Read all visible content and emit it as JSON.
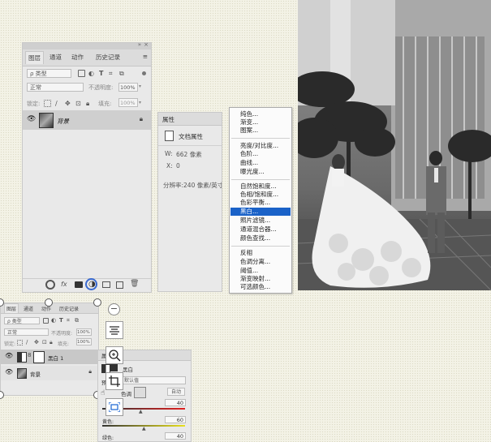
{
  "layers_panel_top": {
    "tabs": [
      "图层",
      "通道",
      "动作",
      "历史记录"
    ],
    "filter_placeholder": "ρ 类型",
    "blend_mode": "正常",
    "opacity_label": "不透明度:",
    "opacity_value": "100%",
    "lock_label": "锁定:",
    "fill_label": "填充:",
    "fill_value": "100%",
    "layer_name": "背景"
  },
  "properties_panel": {
    "title": "属性",
    "doc_label": "文档属性",
    "width_label": "W:",
    "width_value": "662 像素",
    "x_label": "X:",
    "x_value": "0",
    "resolution_label": "分辨率:",
    "resolution_value": "240 像素/英寸"
  },
  "adjustment_menu": {
    "groups": [
      [
        "纯色...",
        "渐变...",
        "图案..."
      ],
      [
        "亮度/对比度...",
        "色阶...",
        "曲线...",
        "曝光度..."
      ],
      [
        "自然饱和度...",
        "色相/饱和度...",
        "色彩平衡...",
        "黑白...",
        "照片滤镜...",
        "通道混合器...",
        "颜色查找..."
      ],
      [
        "反相",
        "色调分离...",
        "阈值...",
        "渐变映射...",
        "可选颜色..."
      ]
    ],
    "selected": "黑白..."
  },
  "layers_panel_bottom": {
    "tabs": [
      "图层",
      "通道",
      "动作",
      "历史记录"
    ],
    "filter_placeholder": "ρ 类型",
    "blend_mode": "正常",
    "opacity_label": "不透明度:",
    "opacity_value": "100%",
    "lock_label": "锁定:",
    "fill_label": "填充:",
    "fill_value": "100%",
    "layer1_name": "黑白 1",
    "layer2_name": "背景"
  },
  "bw_properties": {
    "title": "属性",
    "adjust_label": "黑白",
    "preset_value": "默认值",
    "tint_label": "色调",
    "auto_label": "自动",
    "red_value": "40",
    "yellow_value": "60",
    "yellow_label": "黄色:",
    "green_value": "40",
    "green_label": "绿色:"
  },
  "colors": {
    "menu_highlight": "#1a62c8",
    "panel_bg": "#e9e9e9"
  }
}
